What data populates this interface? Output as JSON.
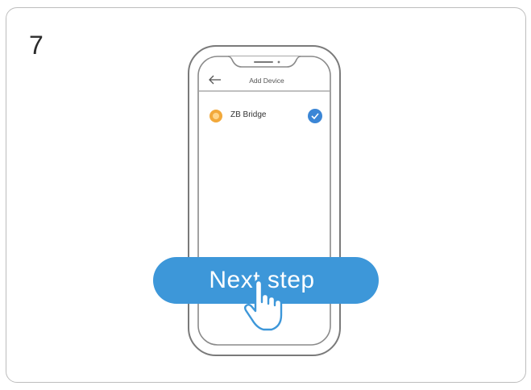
{
  "step": {
    "number": "7"
  },
  "screen": {
    "title": "Add Device",
    "back_icon": "arrow-left-icon"
  },
  "device": {
    "name": "ZB Bridge",
    "icon": "bridge-device-icon",
    "selected": true,
    "check_icon": "checkmark-icon"
  },
  "action": {
    "next_label": "Next step",
    "pointer_icon": "hand-pointer-icon"
  },
  "colors": {
    "accent": "#3d97d9",
    "check": "#3b86d6",
    "device_icon": "#f2a93b"
  }
}
